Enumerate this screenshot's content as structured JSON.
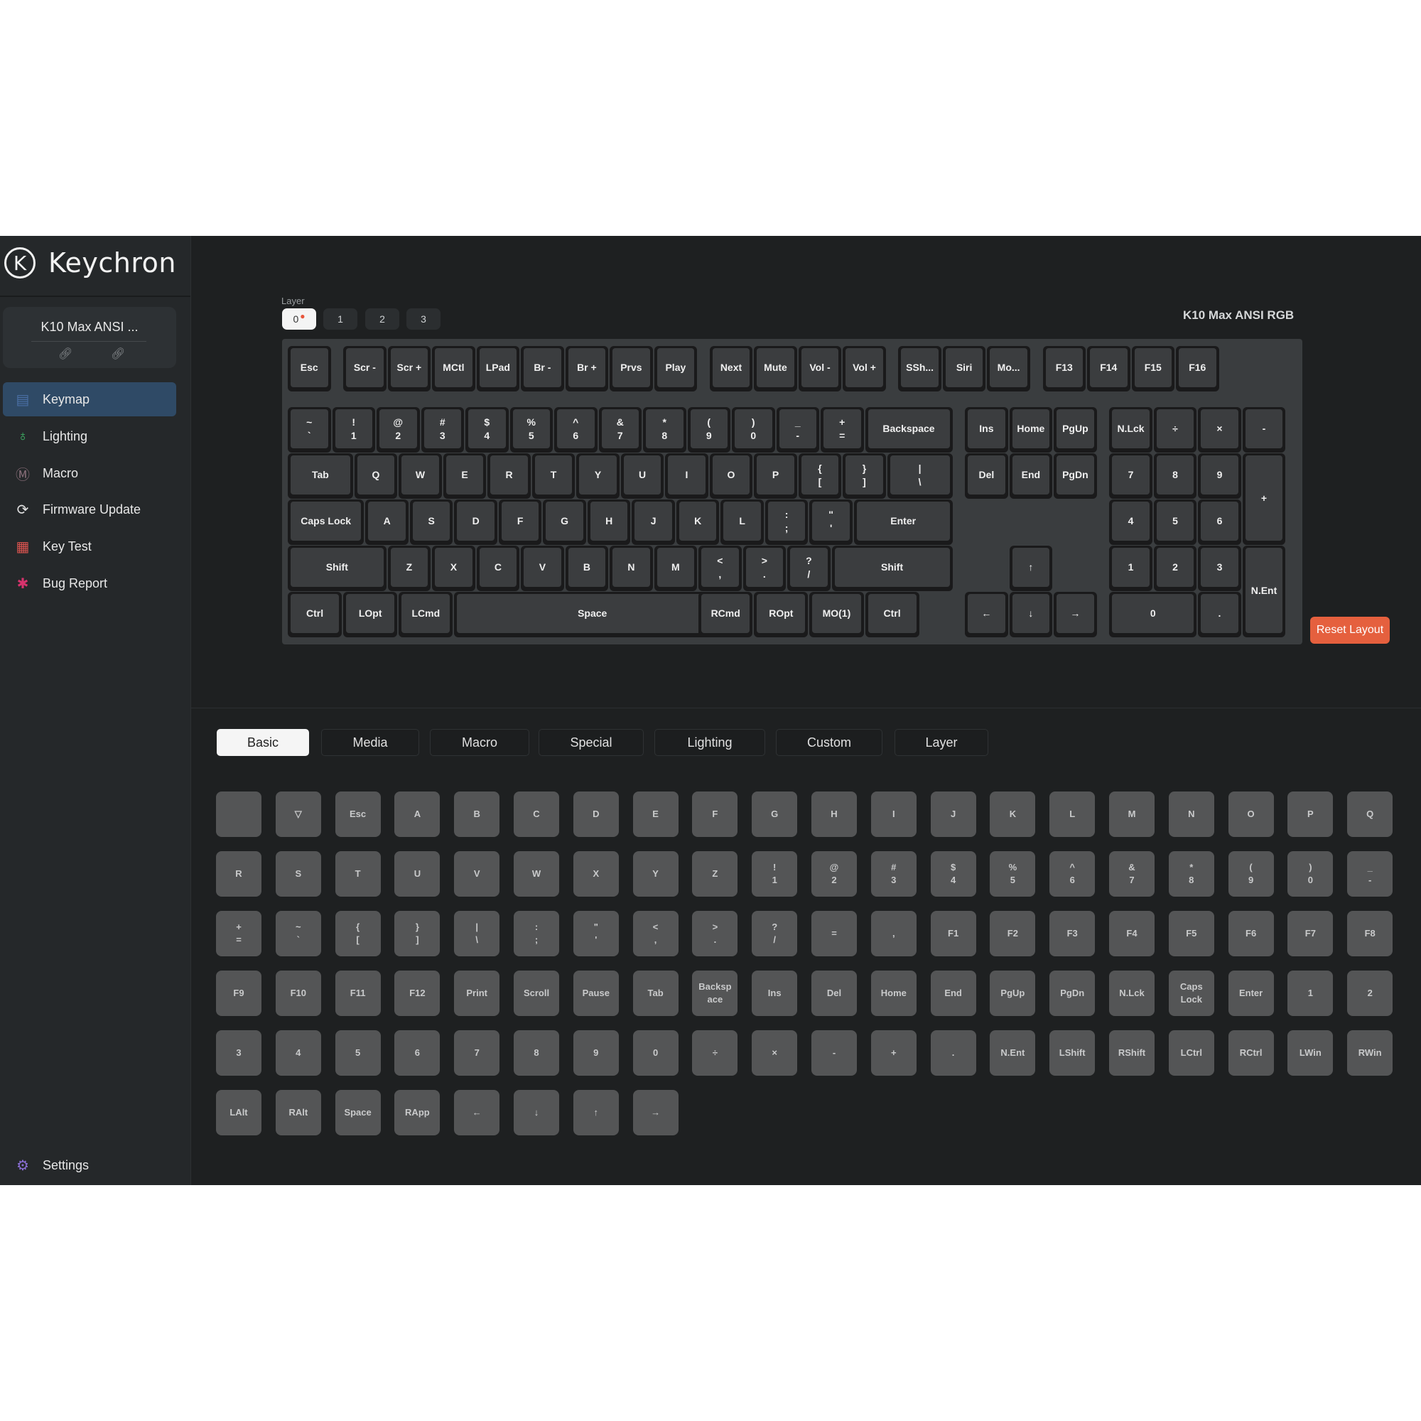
{
  "brand": {
    "name": "Keychron",
    "mark": "K"
  },
  "device": {
    "name": "K10 Max ANSI ..."
  },
  "nav": [
    {
      "label": "Keymap",
      "icon": "keyboard-icon",
      "active": true
    },
    {
      "label": "Lighting",
      "icon": "bulb-icon"
    },
    {
      "label": "Macro",
      "icon": "macro-icon"
    },
    {
      "label": "Firmware Update",
      "icon": "firmware-icon"
    },
    {
      "label": "Key Test",
      "icon": "key-test-icon"
    },
    {
      "label": "Bug Report",
      "icon": "bug-icon"
    }
  ],
  "settings": {
    "label": "Settings",
    "icon": "gear-icon"
  },
  "layers": {
    "label": "Layer",
    "items": [
      "0",
      "1",
      "2",
      "3"
    ],
    "active": 0
  },
  "keyboard_title": "K10 Max ANSI RGB",
  "keyboard": [
    [
      "Esc",
      "Scr -",
      "Scr +",
      "MCtl",
      "LPad",
      "Br -",
      "Br +",
      "Prvs",
      "Play",
      "Next",
      "Mute",
      "Vol -",
      "Vol +",
      "SSh...",
      "Siri",
      "Mo...",
      "F13",
      "F14",
      "F15",
      "F16"
    ],
    [
      "~\n`",
      "!\n1",
      "@\n2",
      "#\n3",
      "$\n4",
      "%\n5",
      "^\n6",
      "&\n7",
      "*\n8",
      "(\n9",
      ")\n0",
      "_\n-",
      "+\n=",
      "Backspace",
      "Ins",
      "Home",
      "PgUp",
      "N.Lck",
      "÷",
      "×",
      "-"
    ],
    [
      "Tab",
      "Q",
      "W",
      "E",
      "R",
      "T",
      "Y",
      "U",
      "I",
      "O",
      "P",
      "{\n[",
      "}\n]",
      "|\n\\",
      "Del",
      "End",
      "PgDn",
      "7",
      "8",
      "9",
      "+"
    ],
    [
      "Caps Lock",
      "A",
      "S",
      "D",
      "F",
      "G",
      "H",
      "J",
      "K",
      "L",
      ":\n;",
      "\"\n'",
      "Enter",
      "4",
      "5",
      "6"
    ],
    [
      "Shift",
      "Z",
      "X",
      "C",
      "V",
      "B",
      "N",
      "M",
      "<\n,",
      ">\n.",
      "?\n/",
      "Shift",
      "↑",
      "1",
      "2",
      "3",
      "N.Ent"
    ],
    [
      "Ctrl",
      "LOpt",
      "LCmd",
      "Space",
      "RCmd",
      "ROpt",
      "MO(1)",
      "Ctrl",
      "←",
      "↓",
      "→",
      "0",
      "."
    ]
  ],
  "reset_label": "Reset Layout",
  "tabs": [
    "Basic",
    "Media",
    "Macro",
    "Special",
    "Lighting",
    "Custom",
    "Layer"
  ],
  "active_tab": 0,
  "palette": [
    "",
    "▽",
    "Esc",
    "A",
    "B",
    "C",
    "D",
    "E",
    "F",
    "G",
    "H",
    "I",
    "J",
    "K",
    "L",
    "M",
    "N",
    "O",
    "P",
    "Q",
    "R",
    "S",
    "T",
    "U",
    "V",
    "W",
    "X",
    "Y",
    "Z",
    "!\n1",
    "@\n2",
    "#\n3",
    "$\n4",
    "%\n5",
    "^\n6",
    "&\n7",
    "*\n8",
    "(\n9",
    ")\n0",
    "_\n-",
    "+\n=",
    "~\n`",
    "{\n[",
    "}\n]",
    "|\n\\",
    ":\n;",
    "\"\n'",
    "<\n,",
    ">\n.",
    "?\n/",
    "=",
    ",",
    "F1",
    "F2",
    "F3",
    "F4",
    "F5",
    "F6",
    "F7",
    "F8",
    "F9",
    "F10",
    "F11",
    "F12",
    "Print",
    "Scroll",
    "Pause",
    "Tab",
    "Backsp\nace",
    "Ins",
    "Del",
    "Home",
    "End",
    "PgUp",
    "PgDn",
    "N.Lck",
    "Caps\nLock",
    "Enter",
    "1",
    "2",
    "3",
    "4",
    "5",
    "6",
    "7",
    "8",
    "9",
    "0",
    "÷",
    "×",
    "-",
    "+",
    ".",
    "N.Ent",
    "LShift",
    "RShift",
    "LCtrl",
    "RCtrl",
    "LWin",
    "RWin",
    "LAlt",
    "RAlt",
    "Space",
    "RApp",
    "←",
    "↓",
    "↑",
    "→"
  ],
  "colors": {
    "accent": "#e5603e",
    "active_nav": "#2f4a66",
    "app_bg": "#1e2021",
    "key": "#3b3d3f",
    "palette_key": "#545556"
  }
}
